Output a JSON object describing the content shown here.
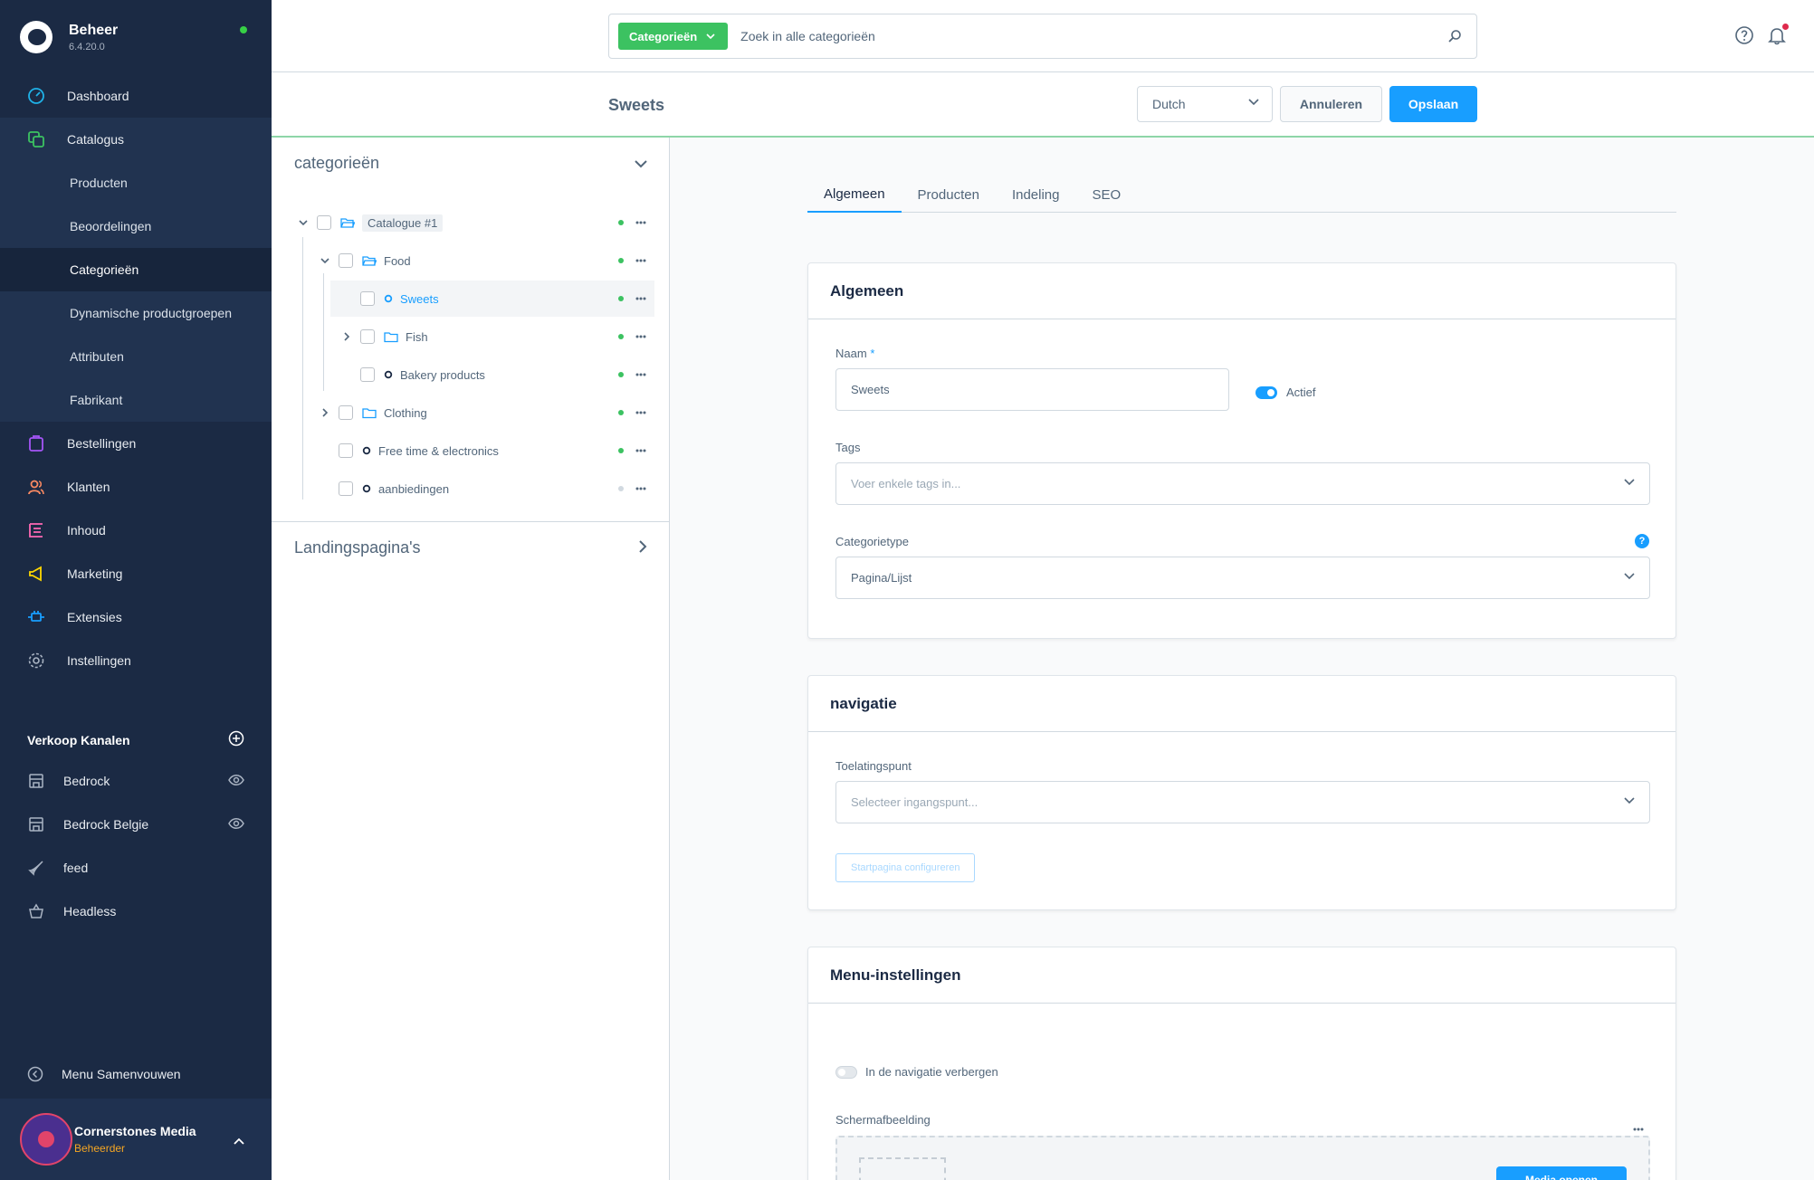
{
  "app": {
    "name": "Beheer",
    "version": "6.4.20.0",
    "status_color": "#37d046"
  },
  "sidebar": {
    "items": [
      {
        "label": "Dashboard",
        "icon": "dashboard-icon"
      },
      {
        "label": "Catalogus",
        "icon": "catalog-icon"
      },
      {
        "label": "Bestellingen",
        "icon": "orders-icon"
      },
      {
        "label": "Klanten",
        "icon": "customers-icon"
      },
      {
        "label": "Inhoud",
        "icon": "content-icon"
      },
      {
        "label": "Marketing",
        "icon": "marketing-icon"
      },
      {
        "label": "Extensies",
        "icon": "extensions-icon"
      },
      {
        "label": "Instellingen",
        "icon": "settings-icon"
      }
    ],
    "catalog_sub": [
      {
        "label": "Producten"
      },
      {
        "label": "Beoordelingen"
      },
      {
        "label": "Categorieën"
      },
      {
        "label": "Dynamische productgroepen"
      },
      {
        "label": "Attributen"
      },
      {
        "label": "Fabrikant"
      }
    ],
    "sales_channels_title": "Verkoop Kanalen",
    "sales_channels": [
      {
        "label": "Bedrock",
        "icon": "storefront-icon"
      },
      {
        "label": "Bedrock Belgie",
        "icon": "storefront-icon"
      },
      {
        "label": "feed",
        "icon": "rocket-icon"
      },
      {
        "label": "Headless",
        "icon": "basket-icon"
      }
    ],
    "collapse_label": "Menu Samenvouwen",
    "user": {
      "name": "Cornerstones Media",
      "role": "Beheerder"
    }
  },
  "topbar": {
    "search_type": "Categorieën",
    "search_placeholder": "Zoek in alle categorieën"
  },
  "smartbar": {
    "title": "Sweets",
    "language": "Dutch",
    "cancel_label": "Annuleren",
    "save_label": "Opslaan"
  },
  "tree": {
    "title": "categorieën",
    "items": [
      {
        "label": "Catalogue #1",
        "status": "active"
      },
      {
        "label": "Food",
        "status": "active"
      },
      {
        "label": "Sweets",
        "status": "active"
      },
      {
        "label": "Fish",
        "status": "active"
      },
      {
        "label": "Bakery products",
        "status": "active"
      },
      {
        "label": "Clothing",
        "status": "active"
      },
      {
        "label": "Free time & electronics",
        "status": "active"
      },
      {
        "label": "aanbiedingen",
        "status": "inactive"
      }
    ],
    "landing_title": "Landingspagina's"
  },
  "tabs": [
    {
      "label": "Algemeen"
    },
    {
      "label": "Producten"
    },
    {
      "label": "Indeling"
    },
    {
      "label": "SEO"
    }
  ],
  "general_card": {
    "title": "Algemeen",
    "name_label": "Naam",
    "name_required": "*",
    "name_value": "Sweets",
    "active_label": "Actief",
    "tags_label": "Tags",
    "tags_placeholder": "Voer enkele tags in...",
    "type_label": "Categorietype",
    "type_value": "Pagina/Lijst"
  },
  "nav_card": {
    "title": "navigatie",
    "entry_label": "Toelatingspunt",
    "entry_placeholder": "Selecteer ingangspunt...",
    "configure_label": "Startpagina configureren"
  },
  "menu_card": {
    "title": "Menu-instellingen",
    "hide_label": "In de navigatie verbergen",
    "image_label": "Schermafbeelding",
    "media_button_label": "Media openen"
  },
  "colors": {
    "sidebar_bg": "#1b2a44",
    "primary": "#189eff",
    "green": "#3cc261",
    "text": "#52667a"
  }
}
